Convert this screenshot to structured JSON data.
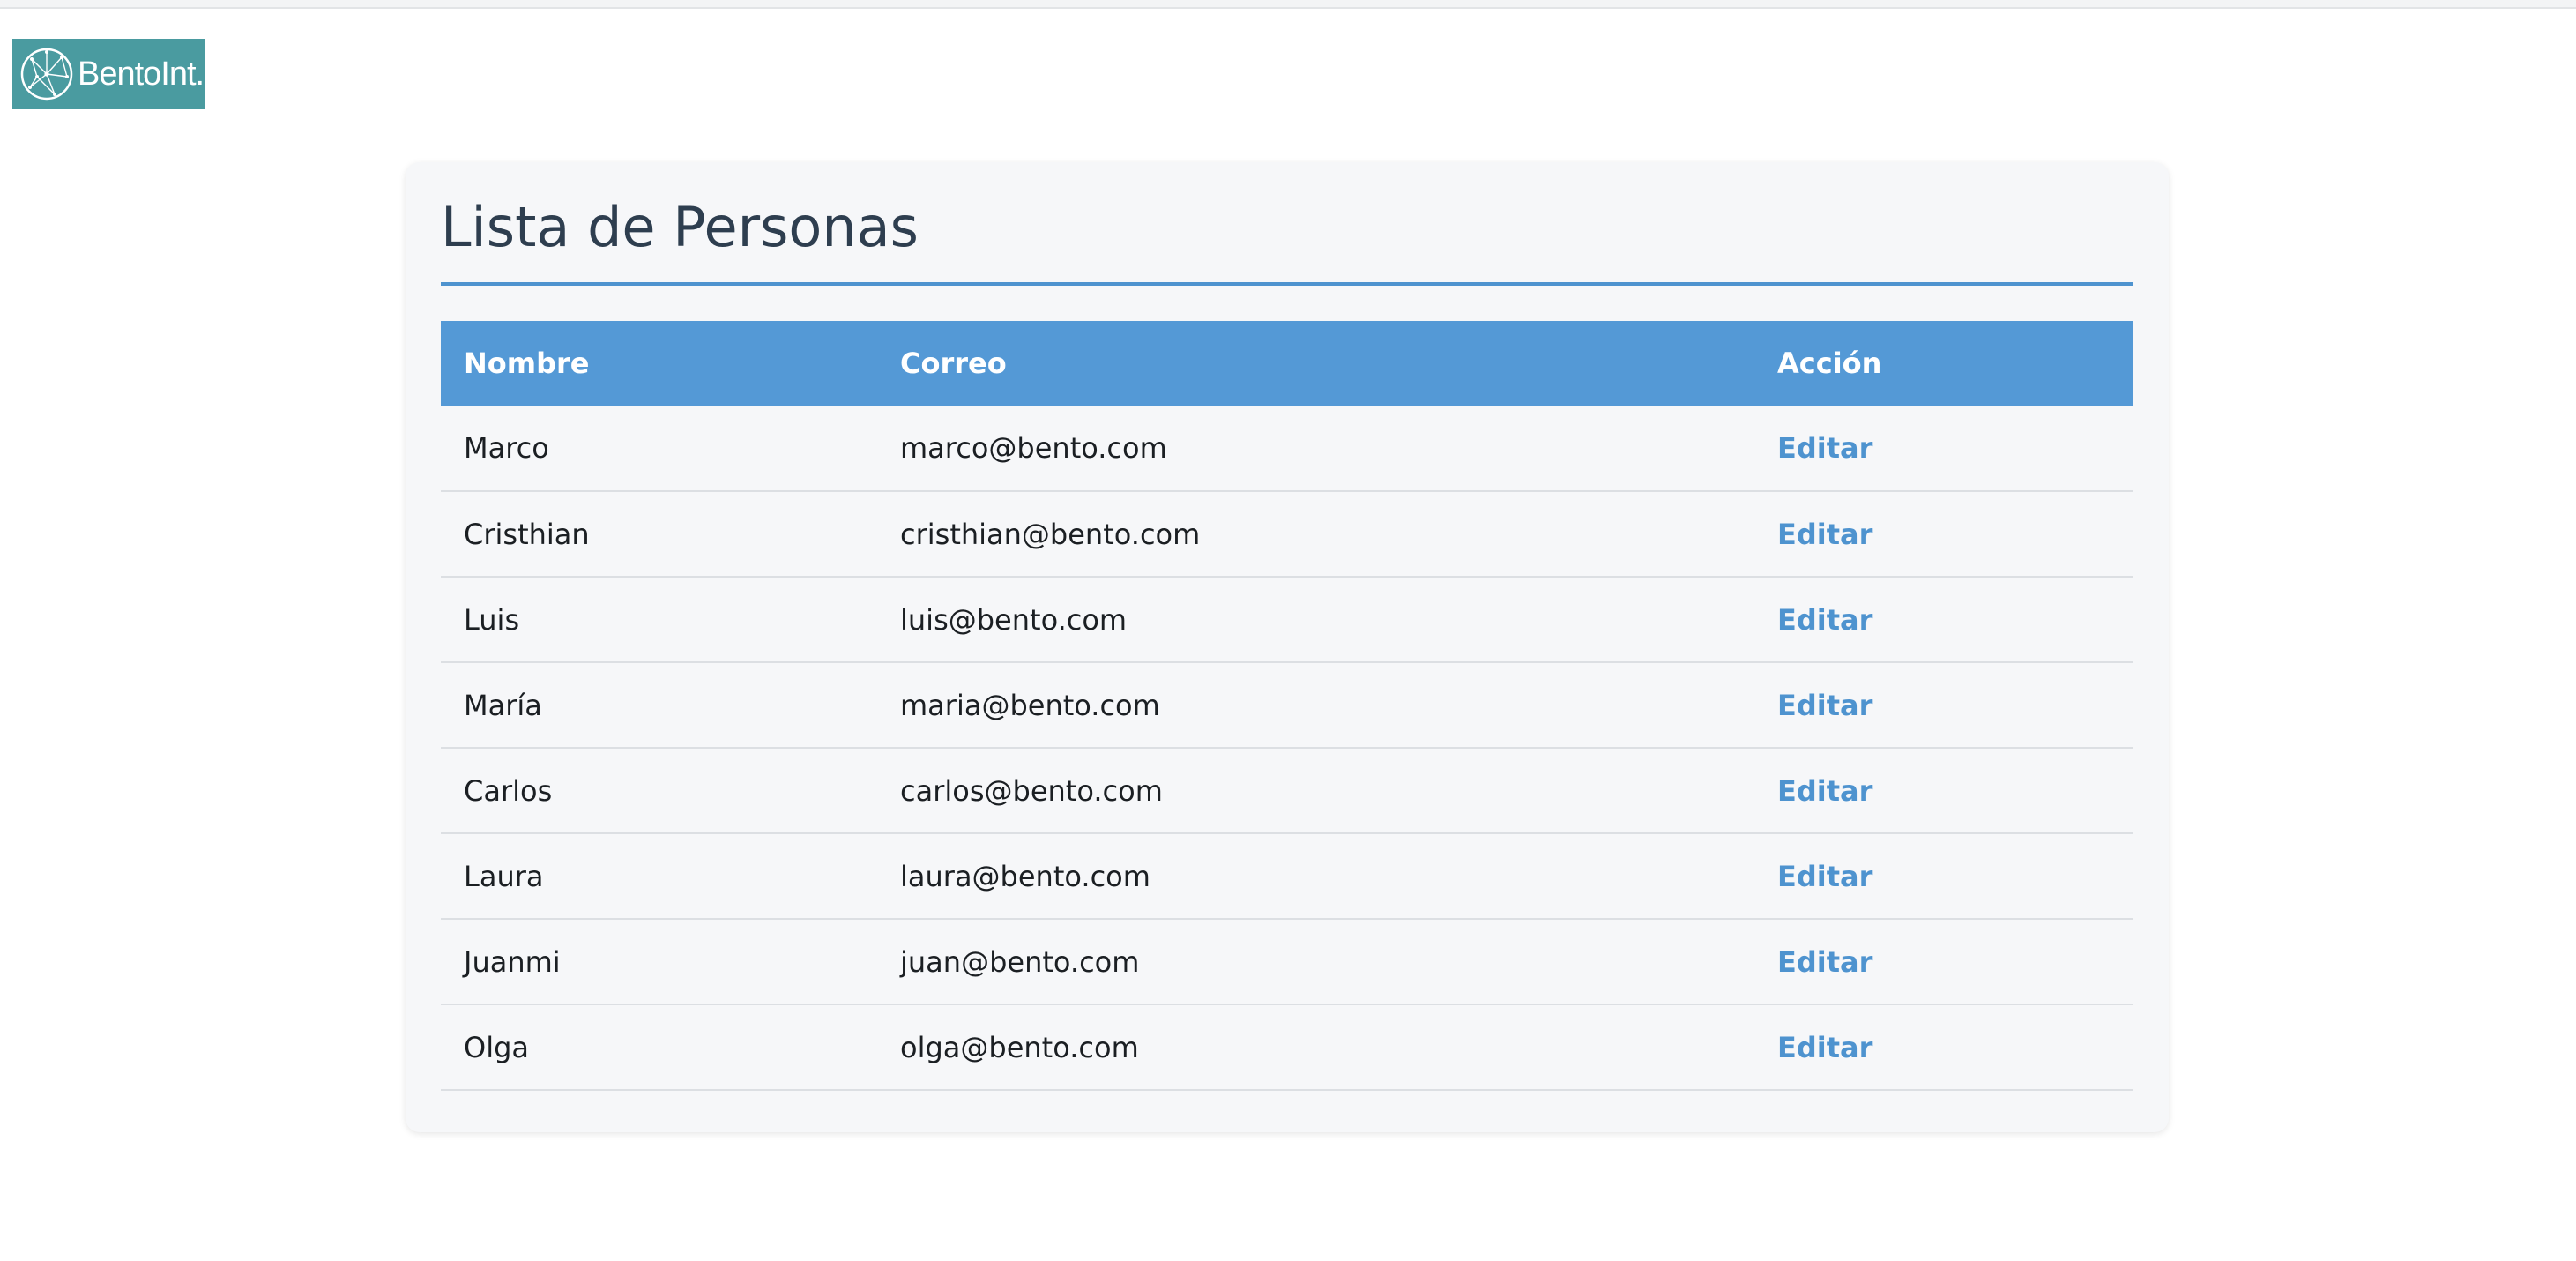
{
  "brand": {
    "logo_text": "BentoInt.",
    "logo_color": "#4a9ba0"
  },
  "page": {
    "title": "Lista de Personas"
  },
  "table": {
    "headers": [
      "Nombre",
      "Correo",
      "Acción"
    ],
    "rows": [
      {
        "name": "Marco",
        "email": "marco@bento.com",
        "action": "Editar"
      },
      {
        "name": "Cristhian",
        "email": "cristhian@bento.com",
        "action": "Editar"
      },
      {
        "name": "Luis",
        "email": "luis@bento.com",
        "action": "Editar"
      },
      {
        "name": "María",
        "email": "maria@bento.com",
        "action": "Editar"
      },
      {
        "name": "Carlos",
        "email": "carlos@bento.com",
        "action": "Editar"
      },
      {
        "name": "Laura",
        "email": "laura@bento.com",
        "action": "Editar"
      },
      {
        "name": "Juanmi",
        "email": "juan@bento.com",
        "action": "Editar"
      },
      {
        "name": "Olga",
        "email": "olga@bento.com",
        "action": "Editar"
      }
    ]
  },
  "colors": {
    "accent": "#5499d6",
    "link": "#4e93cf",
    "title": "#2e3e4f",
    "card_bg": "#f6f7f9"
  }
}
